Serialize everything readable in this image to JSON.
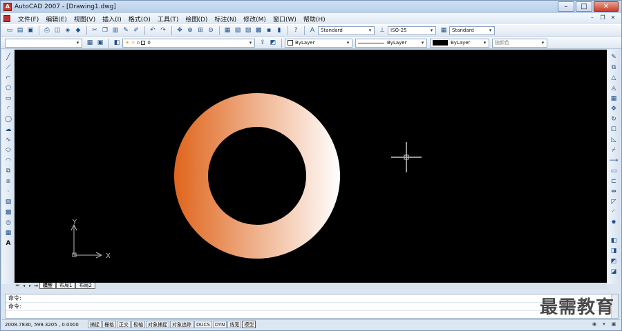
{
  "window": {
    "title": "AutoCAD 2007 - [Drawing1.dwg]",
    "app_icon": "A",
    "minimize": "–",
    "maximize": "□",
    "close": "✕"
  },
  "menubar": {
    "items": [
      {
        "label": "文件(F)"
      },
      {
        "label": "编辑(E)"
      },
      {
        "label": "视图(V)"
      },
      {
        "label": "插入(I)"
      },
      {
        "label": "格式(O)"
      },
      {
        "label": "工具(T)"
      },
      {
        "label": "绘图(D)"
      },
      {
        "label": "标注(N)"
      },
      {
        "label": "修改(M)"
      },
      {
        "label": "窗口(W)"
      },
      {
        "label": "帮助(H)"
      }
    ],
    "mdi_min": "–",
    "mdi_restore": "❐",
    "mdi_close": "✕"
  },
  "styles_toolbar": {
    "text_style": "Standard",
    "dim_style": "ISO-25",
    "table_style": "Standard"
  },
  "layers_toolbar": {
    "layer_name": "0",
    "color": "ByLayer",
    "linetype": "ByLayer",
    "lineweight": "ByLayer",
    "plot_style": "随颜色"
  },
  "canvas": {
    "background": "#000000",
    "ring_gradient_start": "#e0651c",
    "ring_gradient_end": "#ffffff",
    "crosshair_color": "#c8c8c8",
    "ucs_x": "X",
    "ucs_y": "Y"
  },
  "tabs": {
    "items": [
      {
        "label": "模型",
        "active": true
      },
      {
        "label": "布局1",
        "active": false
      },
      {
        "label": "布局2",
        "active": false
      }
    ]
  },
  "command": {
    "line1": "命令:",
    "line2": "命令:"
  },
  "watermark": "最需教育",
  "statusbar": {
    "coords": "2008.7830, 599.3205 , 0.0000",
    "buttons": [
      {
        "label": "捕捉",
        "on": false
      },
      {
        "label": "栅格",
        "on": false
      },
      {
        "label": "正交",
        "on": false
      },
      {
        "label": "极轴",
        "on": false
      },
      {
        "label": "对象捕捉",
        "on": false
      },
      {
        "label": "对象追踪",
        "on": false
      },
      {
        "label": "DUCS",
        "on": false
      },
      {
        "label": "DYN",
        "on": false
      },
      {
        "label": "线宽",
        "on": false
      },
      {
        "label": "模型",
        "on": true
      }
    ]
  }
}
